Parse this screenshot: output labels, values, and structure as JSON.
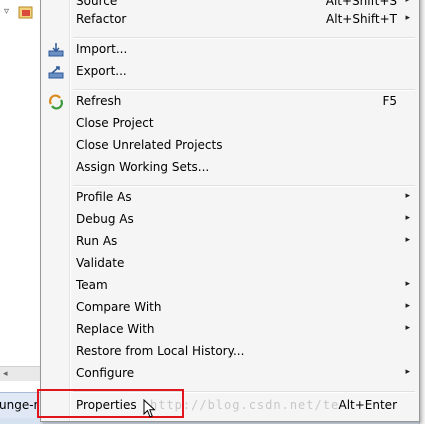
{
  "menu": {
    "items": [
      {
        "label": "Source",
        "accel": "Alt+Shift+S",
        "arrow": "▸"
      },
      {
        "label": "Refactor",
        "accel": "Alt+Shift+T",
        "arrow": "▸"
      },
      {
        "label": "Import...",
        "icon": "import-icon"
      },
      {
        "label": "Export...",
        "icon": "export-icon"
      },
      {
        "label": "Refresh",
        "accel": "F5",
        "icon": "refresh-icon"
      },
      {
        "label": "Close Project"
      },
      {
        "label": "Close Unrelated Projects"
      },
      {
        "label": "Assign Working Sets..."
      },
      {
        "label": "Profile As",
        "arrow": "▸"
      },
      {
        "label": "Debug As",
        "arrow": "▸"
      },
      {
        "label": "Run As",
        "arrow": "▸"
      },
      {
        "label": "Validate"
      },
      {
        "label": "Team",
        "arrow": "▸"
      },
      {
        "label": "Compare With",
        "arrow": "▸"
      },
      {
        "label": "Replace With",
        "arrow": "▸"
      },
      {
        "label": "Restore from Local History..."
      },
      {
        "label": "Configure",
        "arrow": "▸"
      },
      {
        "label": "Properties",
        "accel": "Alt+Enter"
      }
    ]
  },
  "background": {
    "tab_label": "unge-r"
  },
  "watermark": "http://blog.csdn.net/te",
  "colors": {
    "highlight_border": "#e0161c",
    "menu_bg": "#f5f5f5"
  }
}
